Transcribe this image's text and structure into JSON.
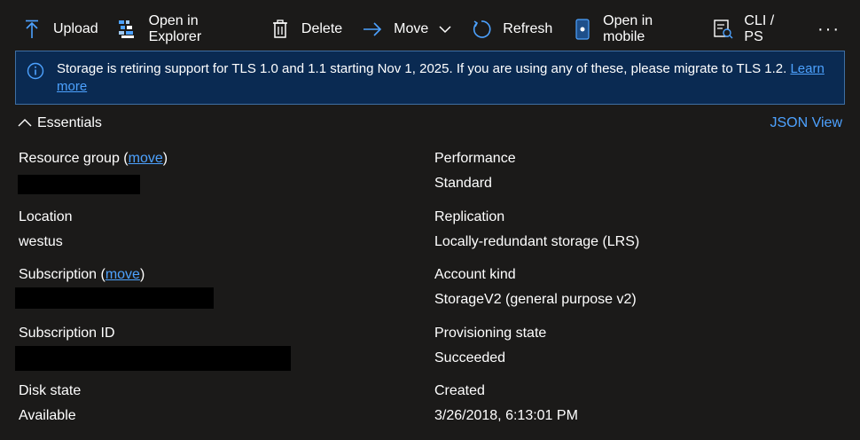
{
  "toolbar": {
    "upload": "Upload",
    "open_in_explorer": "Open in Explorer",
    "delete": "Delete",
    "move": "Move",
    "refresh": "Refresh",
    "open_in_mobile": "Open in mobile",
    "cli_ps": "CLI / PS",
    "more": "···"
  },
  "banner": {
    "text": "Storage is retiring support for TLS 1.0 and 1.1 starting Nov 1, 2025. If you are using any of these, please migrate to TLS 1.2.",
    "link": "Learn more"
  },
  "essentials": {
    "title": "Essentials",
    "json_view": "JSON View"
  },
  "left_props": {
    "resource_group_label": "Resource group (",
    "resource_group_move": "move",
    "resource_group_close": ")",
    "location_label": "Location",
    "location_value": "westus",
    "subscription_label": "Subscription (",
    "subscription_move": "move",
    "subscription_close": ")",
    "subscription_id_label": "Subscription ID",
    "disk_state_label": "Disk state",
    "disk_state_value": "Available"
  },
  "right_props": {
    "performance_label": "Performance",
    "performance_value": "Standard",
    "replication_label": "Replication",
    "replication_value": "Locally-redundant storage (LRS)",
    "account_kind_label": "Account kind",
    "account_kind_value": "StorageV2 (general purpose v2)",
    "provisioning_label": "Provisioning state",
    "provisioning_value": "Succeeded",
    "created_label": "Created",
    "created_value": "3/26/2018, 6:13:01 PM"
  },
  "colors": {
    "background": "#1b1a19",
    "banner_bg": "#0a2a52",
    "link": "#4da2ff"
  }
}
